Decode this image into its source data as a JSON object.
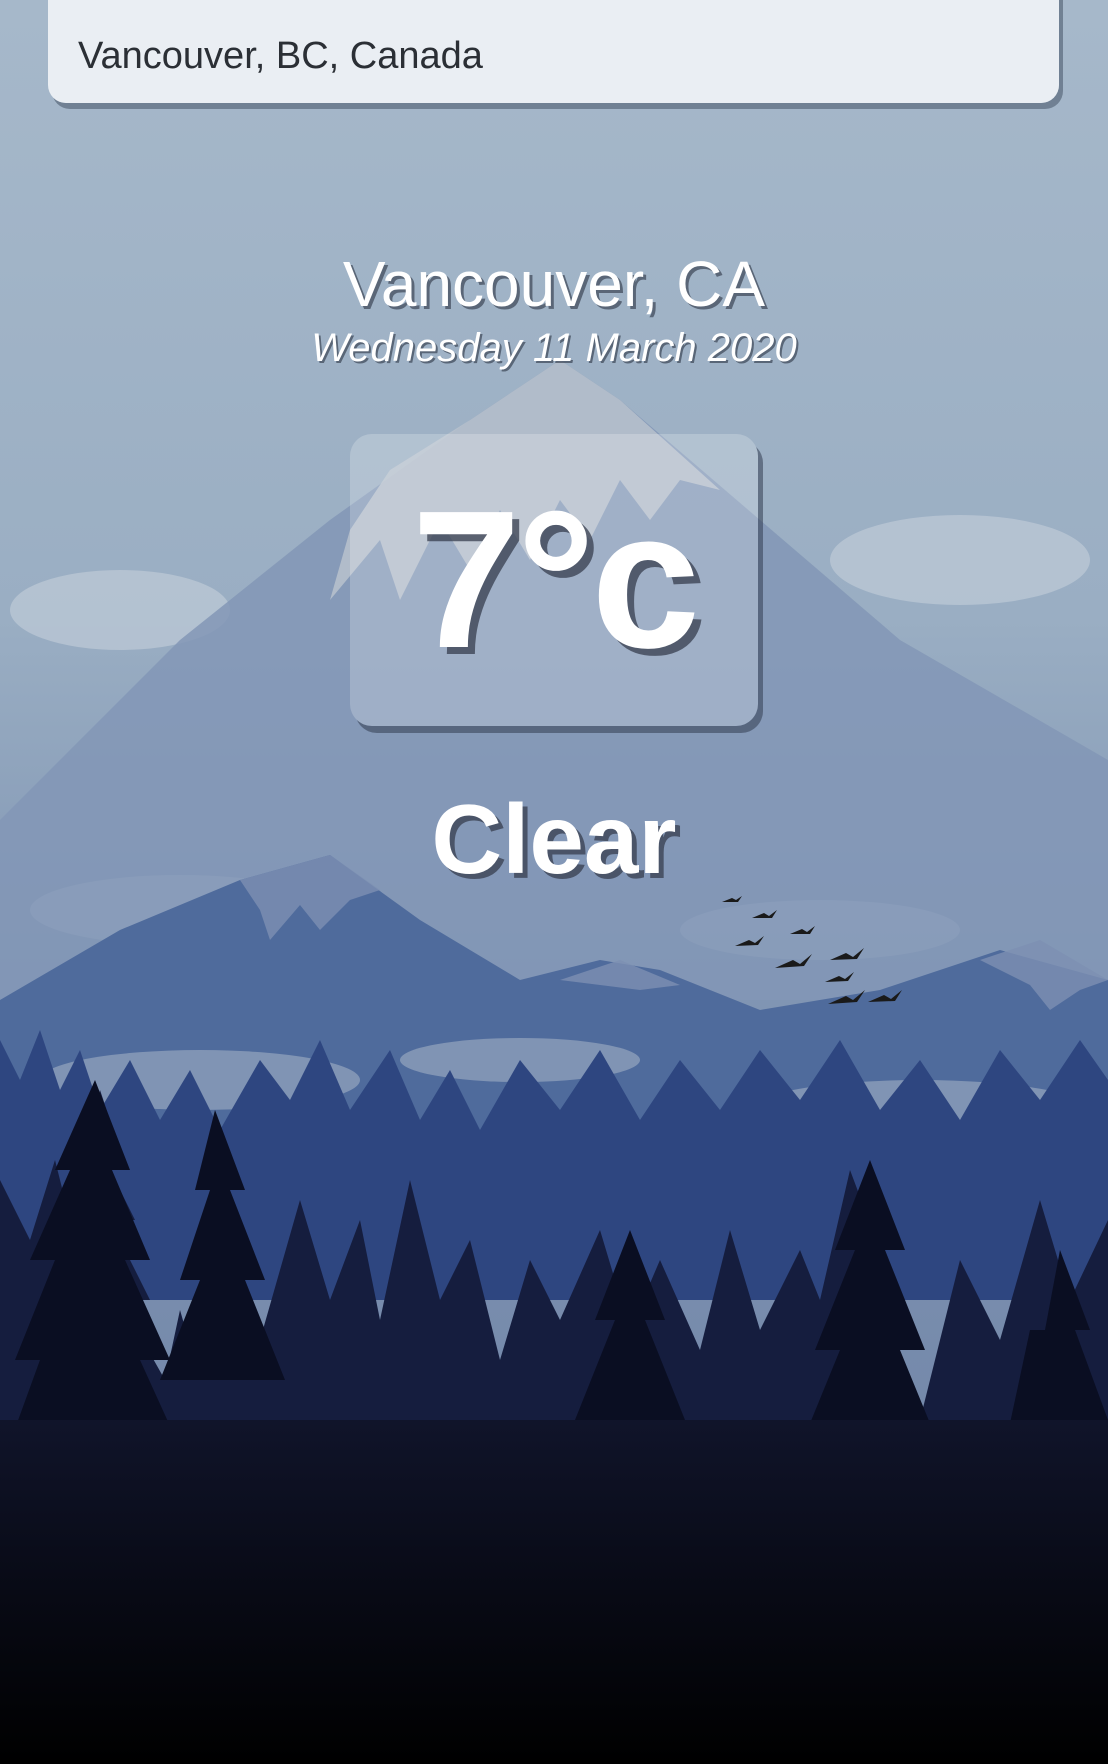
{
  "search": {
    "value": "Vancouver, BC, Canada"
  },
  "weather": {
    "location": "Vancouver, CA",
    "date": "Wednesday 11 March 2020",
    "temperature": "7°c",
    "condition": "Clear"
  },
  "background": {
    "name": "mountain-forest-landscape",
    "sky_color": "#9fb2c5",
    "mountain_color": "#6f87aa",
    "forest_color": "#1f2f5c",
    "ground_color": "#000000"
  }
}
